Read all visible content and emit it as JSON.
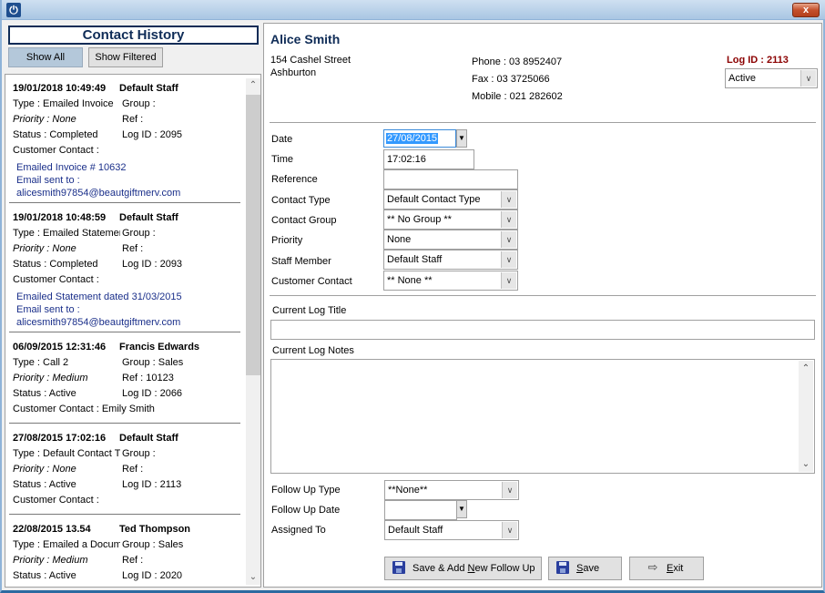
{
  "window": {
    "close_label": "x"
  },
  "history": {
    "title": "Contact History",
    "show_all_label": "Show All",
    "show_filtered_label": "Show Filtered",
    "entries": [
      {
        "datetime": "19/01/2018  10:49:49",
        "staff": "Default Staff",
        "type": "Type : Emailed Invoice",
        "group": "Group :",
        "priority": "Priority : None",
        "ref": "Ref :",
        "status": "Status : Completed",
        "log_id": "Log ID : 2095",
        "customer_contact": "Customer Contact :",
        "notes": [
          "Emailed Invoice # 10632",
          "Email sent to :",
          "alicesmith97854@beautgiftmerv.com"
        ]
      },
      {
        "datetime": "19/01/2018  10:48:59",
        "staff": "Default Staff",
        "type": "Type : Emailed Statement",
        "group": "Group :",
        "priority": "Priority : None",
        "ref": "Ref :",
        "status": "Status : Completed",
        "log_id": "Log ID : 2093",
        "customer_contact": "Customer Contact :",
        "notes": [
          "Emailed Statement dated 31/03/2015",
          "Email sent to :",
          "alicesmith97854@beautgiftmerv.com"
        ]
      },
      {
        "datetime": "06/09/2015  12:31:46",
        "staff": "Francis Edwards",
        "type": "Type : Call 2",
        "group": "Group : Sales",
        "priority": "Priority : Medium",
        "ref": "Ref : 10123",
        "status": "Status : Active",
        "log_id": "Log ID : 2066",
        "customer_contact": "Customer Contact : Emily Smith",
        "notes": []
      },
      {
        "datetime": "27/08/2015  17:02:16",
        "staff": "Default Staff",
        "type": "Type : Default Contact Type",
        "group": "Group :",
        "priority": "Priority : None",
        "ref": "Ref :",
        "status": "Status : Active",
        "log_id": "Log ID : 2113",
        "customer_contact": "Customer Contact :",
        "notes": []
      },
      {
        "datetime": "22/08/2015  13.54",
        "staff": "Ted Thompson",
        "type": "Type : Emailed a Document",
        "group": "Group : Sales",
        "priority": "Priority : Medium",
        "ref": "Ref :",
        "status": "Status : Active",
        "log_id": "Log ID : 2020",
        "customer_contact": "",
        "notes": []
      }
    ]
  },
  "customer": {
    "name": "Alice Smith",
    "address_line1": "154 Cashel Street",
    "address_line2": "Ashburton",
    "phone": "Phone : 03 8952407",
    "fax": "Fax : 03 3725066",
    "mobile": "Mobile : 021 282602",
    "log_id": "Log ID : 2113",
    "status_value": "Active"
  },
  "form": {
    "date_label": "Date",
    "date_value": "27/08/2015",
    "time_label": "Time",
    "time_value": "17:02:16",
    "reference_label": "Reference",
    "reference_value": "",
    "contact_type_label": "Contact Type",
    "contact_type_value": "Default Contact Type",
    "contact_group_label": "Contact Group",
    "contact_group_value": "** No Group **",
    "priority_label": "Priority",
    "priority_value": "None",
    "staff_member_label": "Staff Member",
    "staff_member_value": "Default Staff",
    "customer_contact_label": "Customer Contact",
    "customer_contact_value": "** None **",
    "log_title_label": "Current Log Title",
    "log_title_value": "",
    "log_notes_label": "Current Log Notes",
    "log_notes_value": "",
    "follow_up_type_label": "Follow Up Type",
    "follow_up_type_value": "**None**",
    "follow_up_date_label": "Follow Up Date",
    "follow_up_date_value": "",
    "assigned_to_label": "Assigned To",
    "assigned_to_value": "Default Staff"
  },
  "actions": {
    "save_add_prefix": "Save & Add ",
    "save_add_underline": "N",
    "save_add_suffix": "ew Follow Up",
    "save_underline": "S",
    "save_suffix": "ave",
    "exit_underline": "E",
    "exit_suffix": "xit"
  }
}
